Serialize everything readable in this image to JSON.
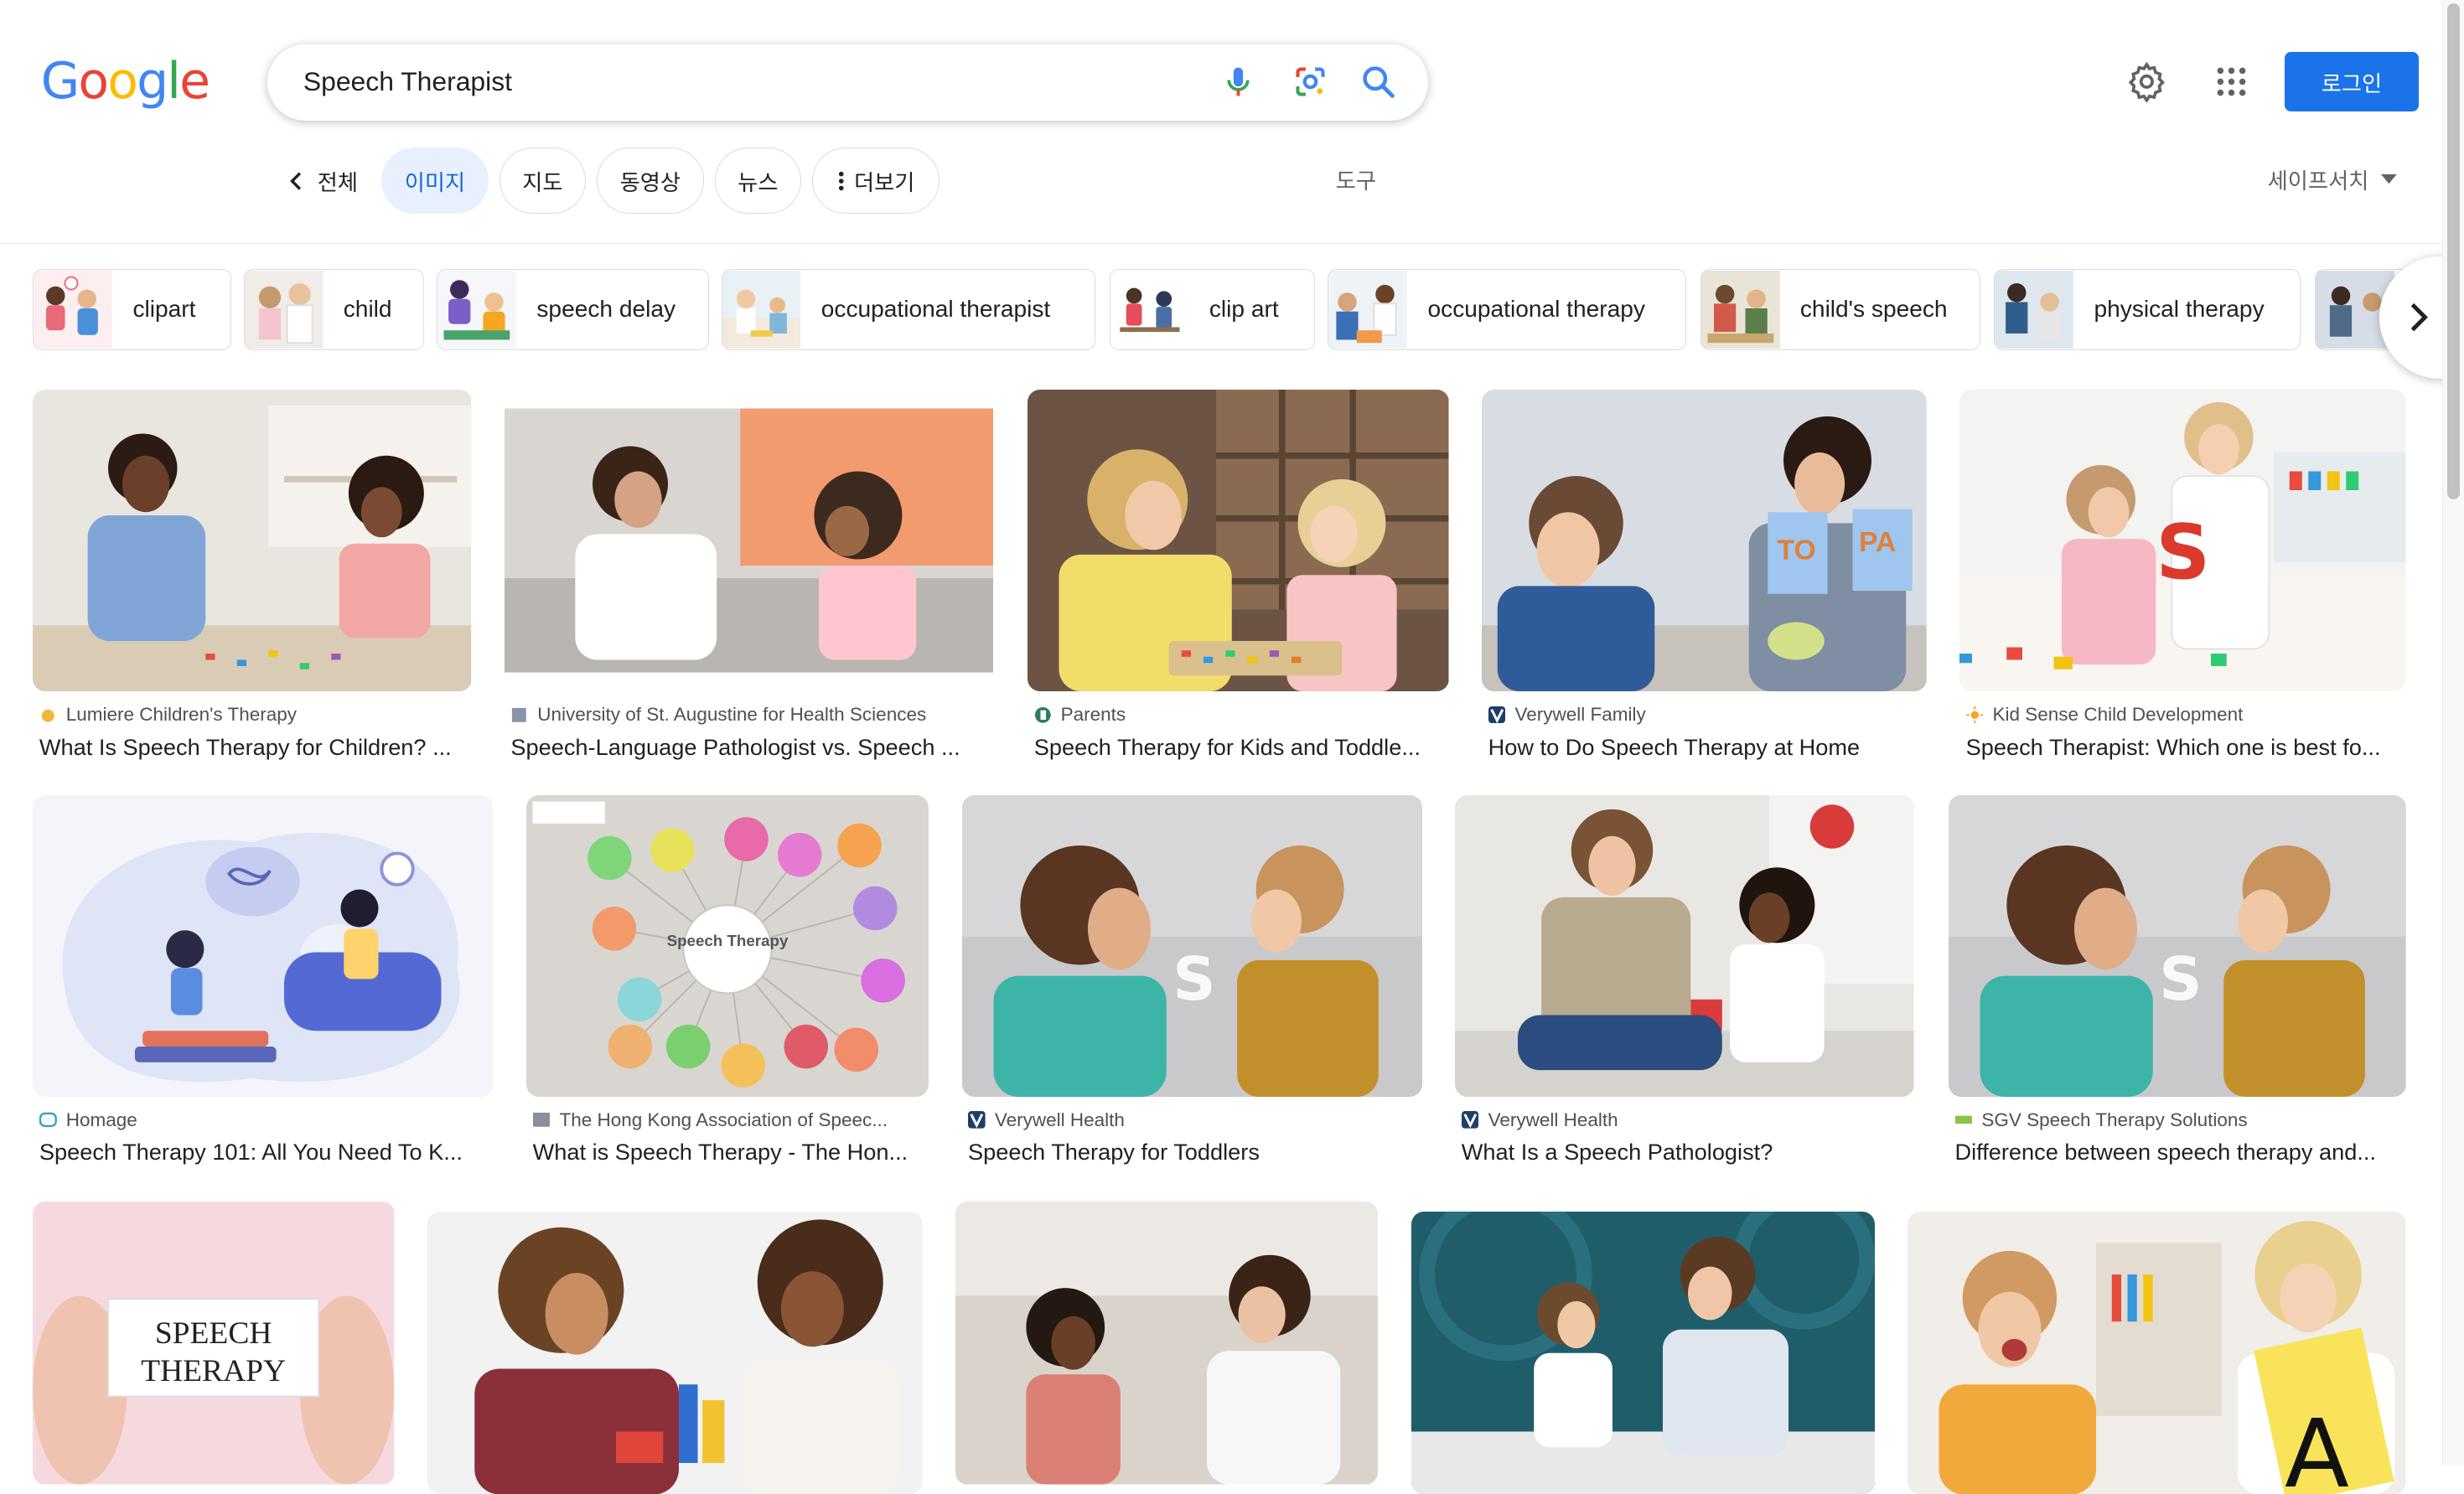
{
  "search": {
    "query": "Speech Therapist"
  },
  "header": {
    "login_label": "로그인"
  },
  "tabs": {
    "back_label": "전체",
    "items": [
      "이미지",
      "지도",
      "동영상",
      "뉴스"
    ],
    "more_label": "더보기",
    "tools_label": "도구",
    "safesearch_label": "세이프서치"
  },
  "chips": [
    {
      "label": "clipart"
    },
    {
      "label": "child"
    },
    {
      "label": "speech delay"
    },
    {
      "label": "occupational therapist"
    },
    {
      "label": "clip art"
    },
    {
      "label": "occupational therapy"
    },
    {
      "label": "child's speech"
    },
    {
      "label": "physical therapy"
    }
  ],
  "results": [
    {
      "source": "Lumiere Children's Therapy",
      "title": "What Is Speech Therapy for Children? ..."
    },
    {
      "source": "University of St. Augustine for Health Sciences",
      "title": "Speech-Language Pathologist vs. Speech ..."
    },
    {
      "source": "Parents",
      "title": "Speech Therapy for Kids and Toddle..."
    },
    {
      "source": "Verywell Family",
      "title": "How to Do Speech Therapy at Home"
    },
    {
      "source": "Kid Sense Child Development",
      "title": "Speech Therapist: Which one is best fo..."
    },
    {
      "source": "Homage",
      "title": "Speech Therapy 101: All You Need To K..."
    },
    {
      "source": "The Hong Kong Association of Speec...",
      "title": "What is Speech Therapy - The Hon..."
    },
    {
      "source": "Verywell Health",
      "title": "Speech Therapy for Toddlers"
    },
    {
      "source": "Verywell Health",
      "title": "What Is a Speech Pathologist?"
    },
    {
      "source": "SGV Speech Therapy Solutions",
      "title": "Difference between speech therapy and..."
    }
  ],
  "image_text": {
    "speech_card": [
      "SPEECH",
      "THERAPY"
    ],
    "speech_center": "Speech Therapy",
    "flashcards": [
      "TO",
      "PA"
    ],
    "letter_s": "S",
    "letter_a": "A"
  },
  "colors": {
    "accent": "#1a73e8",
    "active_tab_bg": "#e8f0fe",
    "active_tab_text": "#1967d2",
    "logo": [
      "#4285f4",
      "#ea4335",
      "#fbbc05",
      "#4285f4",
      "#34a853",
      "#ea4335"
    ]
  }
}
